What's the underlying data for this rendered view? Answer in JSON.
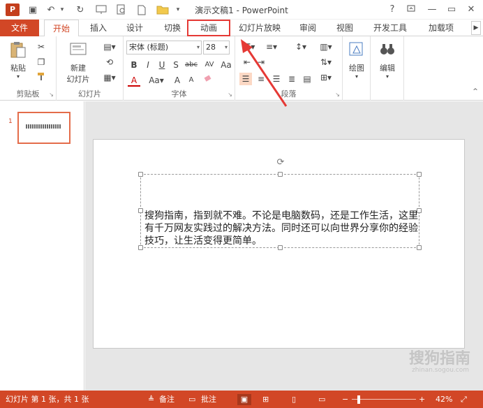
{
  "window": {
    "title": "演示文稿1 - PowerPoint",
    "logo_text": "P",
    "help": "?",
    "minimize": "—",
    "restore": "▭",
    "close": "✕"
  },
  "quick_access": {
    "save": "▣",
    "undo": "↶",
    "redo": "↻",
    "dropdown": "▾"
  },
  "tabs": [
    {
      "label": "文件"
    },
    {
      "label": "开始"
    },
    {
      "label": "插入"
    },
    {
      "label": "设计"
    },
    {
      "label": "切换"
    },
    {
      "label": "动画"
    },
    {
      "label": "幻灯片放映"
    },
    {
      "label": "审阅"
    },
    {
      "label": "视图"
    },
    {
      "label": "开发工具"
    },
    {
      "label": "加载项"
    }
  ],
  "ribbon": {
    "clipboard": {
      "label": "剪贴板",
      "paste": "粘贴"
    },
    "slides": {
      "label": "幻灯片",
      "new_slide_1": "新建",
      "new_slide_2": "幻灯片"
    },
    "font": {
      "label": "字体",
      "font_name": "宋体 (标题)",
      "font_size": "28"
    },
    "paragraph": {
      "label": "段落"
    },
    "drawing": {
      "label": "绘图"
    },
    "editing": {
      "label": "编辑"
    }
  },
  "slide_panel": {
    "slide_number": "1"
  },
  "slide": {
    "body_text": "搜狗指南，指到就不难。不论是电脑数码，还是工作生活，这里有千万网友实践过的解决方法。同时还可以向世界分享你的经验技巧，让生活变得更简单。"
  },
  "status": {
    "slide_info": "幻灯片 第 1 张，共 1 张",
    "notes": "备注",
    "comments": "批注",
    "zoom": "42%"
  },
  "watermark": {
    "brand": "搜狗指南",
    "url": "zhinan.sogou.com"
  },
  "colors": {
    "accent": "#d24726",
    "highlight_box": "#e53935"
  }
}
